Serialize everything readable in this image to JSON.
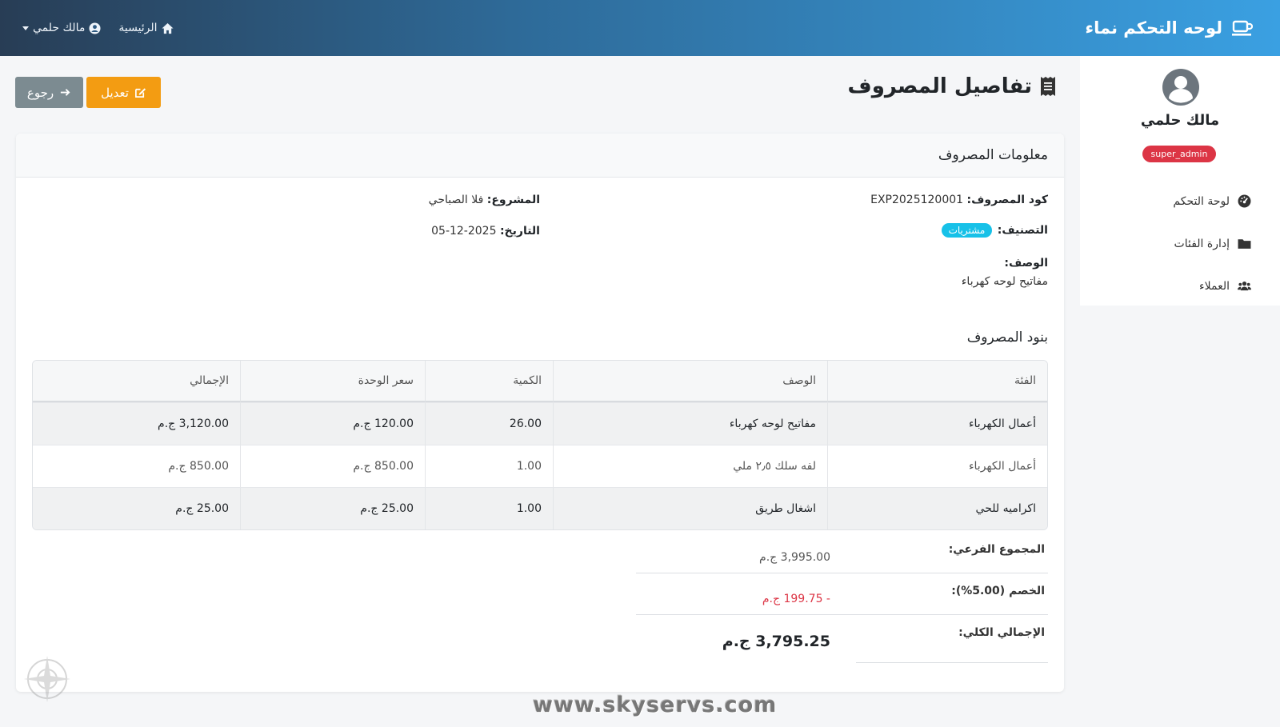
{
  "navbar": {
    "brand": "لوحه التحكم نماء",
    "home_label": "الرئيسية",
    "user_label": "مالك حلمي"
  },
  "sidebar": {
    "user_name": "مالك حلمي",
    "role": "super_admin",
    "items": [
      {
        "label": "لوحة التحكم",
        "icon": "tachometer-icon"
      },
      {
        "label": "إدارة الفئات",
        "icon": "folder-icon"
      },
      {
        "label": "العملاء",
        "icon": "users-icon"
      }
    ]
  },
  "page": {
    "title": "تفاصيل المصروف",
    "edit_label": "تعديل",
    "back_label": "رجوع"
  },
  "card": {
    "header": "معلومات المصروف",
    "code_label": "كود المصروف:",
    "code_value": "EXP2025120001",
    "project_label": "المشروع:",
    "project_value": "فلا الصباحي",
    "category_label": "التصنيف:",
    "category_value": "مشتريات",
    "date_label": "التاريخ:",
    "date_value": "05-12-2025",
    "description_label": "الوصف:",
    "description_value": "مفاتيح لوحه كهرباء",
    "items_title": "بنود المصروف"
  },
  "table": {
    "headers": [
      "الفئة",
      "الوصف",
      "الكمية",
      "سعر الوحدة",
      "الإجمالي"
    ],
    "rows": [
      [
        "أعمال الكهرباء",
        "مفاتيح لوحه كهرباء",
        "26.00",
        "120.00 ج.م",
        "3,120.00 ج.م"
      ],
      [
        "أعمال الكهرباء",
        "لفه سلك ٢٫٥ ملي",
        "1.00",
        "850.00 ج.م",
        "850.00 ج.م"
      ],
      [
        "اكراميه للحي",
        "اشغال طريق",
        "1.00",
        "25.00 ج.م",
        "25.00 ج.م"
      ]
    ]
  },
  "totals": {
    "subtotal_label": "المجموع الفرعي:",
    "subtotal_value": "3,995.00 ج.م",
    "discount_label": "الخصم (5.00%):",
    "discount_value": "- 199.75 ج.م",
    "grand_label": "الإجمالي الكلي:",
    "grand_value": "3,795.25 ج.م"
  },
  "watermark": "www.skyservs.com",
  "colors": {
    "navbar_start": "#3aa0e2",
    "navbar_end": "#283d55",
    "edit_button": "#f39c12",
    "back_button": "#7c8b91",
    "role_badge": "#dc3545",
    "category_badge": "#17c1e8",
    "discount": "#dc3545"
  }
}
